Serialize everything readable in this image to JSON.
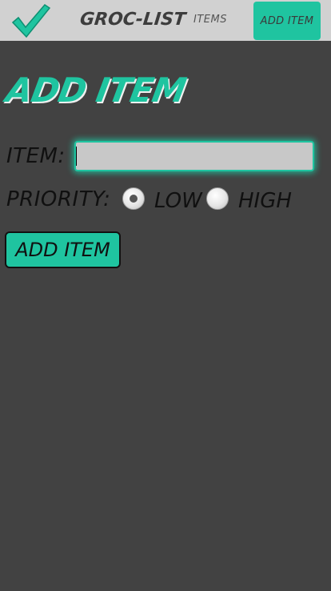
{
  "navbar": {
    "brand": "GROC-LIST",
    "logo_icon": "checkmark-icon",
    "links": {
      "items": "ITEMS",
      "add_item": "ADD ITEM"
    }
  },
  "page": {
    "title": "ADD ITEM"
  },
  "form": {
    "item_label": "ITEM:",
    "item_value": "",
    "item_placeholder": "",
    "priority_label": "PRIORITY:",
    "priority_options": [
      {
        "label": "LOW",
        "selected": true
      },
      {
        "label": "HIGH",
        "selected": false
      }
    ],
    "submit_label": "ADD ITEM"
  },
  "colors": {
    "accent": "#1fc4a0",
    "background": "#424242",
    "navbar": "#d1d1d1"
  }
}
